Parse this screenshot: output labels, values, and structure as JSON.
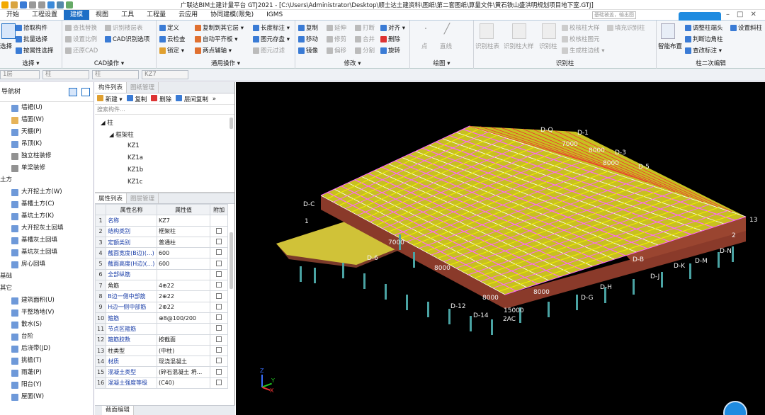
{
  "app": {
    "title": "广联达BIM土建计量平台 GTJ2021 - [C:\\Users\\Administrator\\Desktop\\顺士达土建资料\\图纸\\第二套图纸\\算量文件\\黄石铁山盛洪明规划项目地下室.GTJ]",
    "search_placeholder": "基础被盖，输出图"
  },
  "menu_tabs": [
    "开始",
    "工程设置",
    "建模",
    "视图",
    "工具",
    "工程量",
    "云应用",
    "协同建模(限免)",
    "IGMS"
  ],
  "active_tab": "建模",
  "ribbon": {
    "select_group": {
      "label": "选择 ▾",
      "big": "选择",
      "items": [
        "拾取构件",
        "批量选择",
        "按属性选择"
      ]
    },
    "cad_group": {
      "label": "CAD操作 ▾",
      "items": [
        "查找替换",
        "识别楼层表",
        "设置比例",
        "CAD识别选项",
        "还原CAD"
      ]
    },
    "common_group": {
      "label": "通用操作 ▾",
      "items": [
        "定义",
        "复制到其它层 ▾",
        "长度标注 ▾",
        "云检查",
        "自动平齐板 ▾",
        "图元存盘 ▾",
        "锁定 ▾",
        "两点辅轴 ▾",
        "图元过滤"
      ]
    },
    "modify_group": {
      "label": "修改 ▾",
      "items": [
        "复制",
        "延伸",
        "打断",
        "对齐 ▾",
        "移动",
        "修剪",
        "合并",
        "删除",
        "镜像",
        "偏移",
        "分割",
        "旋转"
      ]
    },
    "draw_group": {
      "label": "绘图 ▾",
      "items": [
        "点",
        "直线"
      ]
    },
    "identify_group": {
      "label": "识别柱",
      "items": [
        "识别柱表",
        "识别柱大样",
        "识别柱",
        "校核柱大样",
        "校核柱图元",
        "生成柱边线 ▾",
        "填充识别柱"
      ]
    },
    "secondary_group": {
      "label": "柱二次编辑",
      "items": [
        "智能布置",
        "调整柱端头",
        "判断边角柱",
        "查改标注 ▾",
        "设置斜柱"
      ]
    }
  },
  "selectors": {
    "floor": "1层",
    "type": "柱",
    "subtype": "柱",
    "component": "KZ7"
  },
  "nav": {
    "title": "导航树",
    "items": [
      {
        "label": "墙裙(U)",
        "cat": false,
        "color": "#4a7fd0"
      },
      {
        "label": "墙面(W)",
        "cat": false,
        "color": "#e0a030"
      },
      {
        "label": "天棚(P)",
        "cat": false,
        "color": "#4a7fd0"
      },
      {
        "label": "吊顶(K)",
        "cat": false,
        "color": "#4a7fd0"
      },
      {
        "label": "独立柱装修",
        "cat": false,
        "color": "#777"
      },
      {
        "label": "单梁装修",
        "cat": false,
        "color": "#777"
      },
      {
        "label": "土方",
        "cat": true,
        "color": ""
      },
      {
        "label": "大开挖土方(W)",
        "cat": false,
        "color": "#4a7fd0"
      },
      {
        "label": "基槽土方(C)",
        "cat": false,
        "color": "#4a7fd0"
      },
      {
        "label": "基坑土方(K)",
        "cat": false,
        "color": "#4a7fd0"
      },
      {
        "label": "大开挖灰土回填",
        "cat": false,
        "color": "#4a7fd0"
      },
      {
        "label": "基槽灰土回填",
        "cat": false,
        "color": "#4a7fd0"
      },
      {
        "label": "基坑灰土回填",
        "cat": false,
        "color": "#4a7fd0"
      },
      {
        "label": "房心回填",
        "cat": false,
        "color": "#4a7fd0"
      },
      {
        "label": "基础",
        "cat": true,
        "color": ""
      },
      {
        "label": "其它",
        "cat": true,
        "color": ""
      },
      {
        "label": "建筑面积(U)",
        "cat": false,
        "color": "#4a7fd0"
      },
      {
        "label": "平整场地(V)",
        "cat": false,
        "color": "#4a7fd0"
      },
      {
        "label": "散水(S)",
        "cat": false,
        "color": "#4a7fd0"
      },
      {
        "label": "台阶",
        "cat": false,
        "color": "#4a7fd0"
      },
      {
        "label": "后浇带(JD)",
        "cat": false,
        "color": "#4a7fd0"
      },
      {
        "label": "挑檐(T)",
        "cat": false,
        "color": "#4a7fd0"
      },
      {
        "label": "雨蓬(P)",
        "cat": false,
        "color": "#4a7fd0"
      },
      {
        "label": "阳台(Y)",
        "cat": false,
        "color": "#4a7fd0"
      },
      {
        "label": "屋面(W)",
        "cat": false,
        "color": "#4a7fd0"
      }
    ]
  },
  "component_panel": {
    "tabs": [
      "构件列表",
      "图纸管理"
    ],
    "toolbar": [
      "新建 ▾",
      "复制",
      "删除",
      "层间复制"
    ],
    "search_placeholder": "搜索构件...",
    "tree": {
      "root": "柱",
      "group": "框架柱",
      "items": [
        "KZ1",
        "KZ1a",
        "KZ1b",
        "KZ1c"
      ]
    }
  },
  "property_panel": {
    "tabs": [
      "属性列表",
      "图层管理"
    ],
    "headers": [
      "属性名称",
      "属性值",
      "附加"
    ],
    "rows": [
      {
        "n": "1",
        "k": "名称",
        "v": "KZ7",
        "chk": false,
        "blue": true
      },
      {
        "n": "2",
        "k": "结构类别",
        "v": "框架柱",
        "chk": true,
        "blue": true
      },
      {
        "n": "3",
        "k": "定额类别",
        "v": "普通柱",
        "chk": true,
        "blue": true
      },
      {
        "n": "4",
        "k": "截面宽度(B边)(...)",
        "v": "600",
        "chk": true,
        "blue": true
      },
      {
        "n": "5",
        "k": "截面高度(H边)(...)",
        "v": "600",
        "chk": true,
        "blue": true
      },
      {
        "n": "6",
        "k": "全部纵筋",
        "v": "",
        "chk": true,
        "blue": true
      },
      {
        "n": "7",
        "k": "角筋",
        "v": "4⊕22",
        "chk": true,
        "blue": false
      },
      {
        "n": "8",
        "k": "B边一侧中部筋",
        "v": "2⊕22",
        "chk": true,
        "blue": true
      },
      {
        "n": "9",
        "k": "H边一侧中部筋",
        "v": "2⊕22",
        "chk": true,
        "blue": true
      },
      {
        "n": "10",
        "k": "箍筋",
        "v": "⊕8@100/200",
        "chk": true,
        "blue": true
      },
      {
        "n": "11",
        "k": "节点区箍筋",
        "v": "",
        "chk": true,
        "blue": true
      },
      {
        "n": "12",
        "k": "箍筋胶数",
        "v": "按截面",
        "chk": true,
        "blue": true
      },
      {
        "n": "13",
        "k": "柱类型",
        "v": "(中柱)",
        "chk": true,
        "blue": false
      },
      {
        "n": "14",
        "k": "材质",
        "v": "现浇混凝土",
        "chk": true,
        "blue": true
      },
      {
        "n": "15",
        "k": "混凝土类型",
        "v": "(碎石混凝土 坍...",
        "chk": true,
        "blue": true
      },
      {
        "n": "16",
        "k": "混凝土强度等级",
        "v": "(C40)",
        "chk": true,
        "blue": true
      }
    ],
    "bottom_tab": "截面编辑"
  },
  "viewport": {
    "axis_labels": [
      "D-Q",
      "D-1",
      "D-3",
      "D-5",
      "D-C",
      "D-6",
      "D-12",
      "D-14",
      "D-G",
      "D-H",
      "D-K",
      "D-M",
      "D-N",
      "D-J",
      "D-B",
      "13",
      "2AC",
      "1",
      "2",
      "7000",
      "8000",
      "8000",
      "8000",
      "15000",
      "7000",
      "8000",
      "8000"
    ],
    "axis_triad": {
      "z": "Z",
      "y": "Y",
      "x": "X"
    }
  },
  "colors": {
    "accent": "#1e6fc6",
    "ribbon_bg": "#f4f6f9",
    "viewport_bg": "#000000",
    "slab": "#e6e600",
    "beam": "#ff66ff",
    "wall": "#8a3a2a",
    "column": "#4aa3a3"
  }
}
